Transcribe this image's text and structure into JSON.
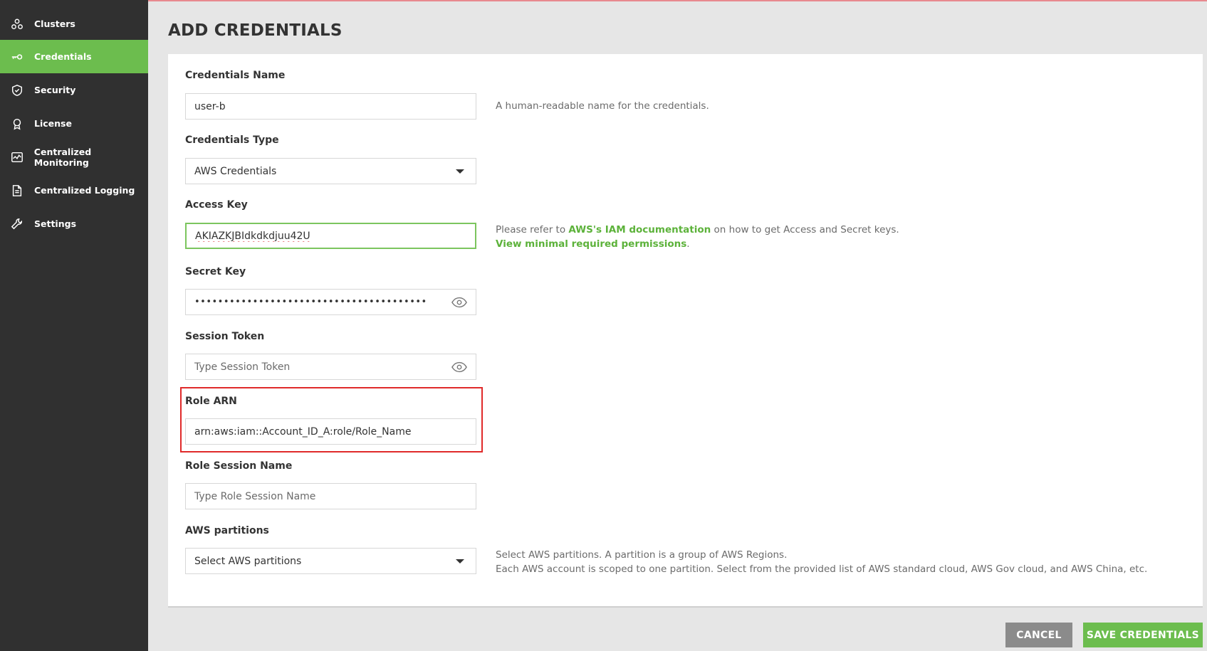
{
  "sidebar": {
    "items": [
      {
        "label": "Clusters",
        "icon": "clusters-icon"
      },
      {
        "label": "Credentials",
        "icon": "key-icon",
        "active": true
      },
      {
        "label": "Security",
        "icon": "shield-icon"
      },
      {
        "label": "License",
        "icon": "license-badge-icon"
      },
      {
        "label": "Centralized Monitoring",
        "icon": "monitoring-chart-icon"
      },
      {
        "label": "Centralized Logging",
        "icon": "document-icon"
      },
      {
        "label": "Settings",
        "icon": "wrench-icon"
      }
    ]
  },
  "page": {
    "title": "ADD CREDENTIALS"
  },
  "form": {
    "credentials_name": {
      "label": "Credentials Name",
      "value": "user-b",
      "help": "A human-readable name for the credentials."
    },
    "credentials_type": {
      "label": "Credentials Type",
      "value": "AWS Credentials"
    },
    "access_key": {
      "label": "Access Key",
      "value": "AKIAZKJBIdkdkdjuu42U",
      "help_prefix": "Please refer to ",
      "help_link": "AWS's IAM documentation",
      "help_suffix": " on how to get Access and Secret keys.",
      "permissions_link": "View minimal required permissions",
      "permissions_suffix": "."
    },
    "secret_key": {
      "label": "Secret Key",
      "value": "••••••••••••••••••••••••••••••••••••••••"
    },
    "session_token": {
      "label": "Session Token",
      "placeholder": "Type Session Token"
    },
    "role_arn": {
      "label": "Role ARN",
      "value": "arn:aws:iam::Account_ID_A:role/Role_Name"
    },
    "role_session_name": {
      "label": "Role Session Name",
      "placeholder": "Type Role Session Name"
    },
    "aws_partitions": {
      "label": "AWS partitions",
      "placeholder": "Select AWS partitions",
      "help_line1": "Select AWS partitions. A partition is a group of AWS Regions.",
      "help_line2": "Each AWS account is scoped to one partition. Select from the provided list of AWS standard cloud, AWS Gov cloud, and AWS China, etc."
    }
  },
  "actions": {
    "cancel_label": "CANCEL",
    "save_label": "SAVE CREDENTIALS"
  },
  "colors": {
    "accent": "#6cbd4e",
    "sidebar_bg": "#303030",
    "highlight": "#e02a2a",
    "cancel_bg": "#8b8b8b"
  }
}
